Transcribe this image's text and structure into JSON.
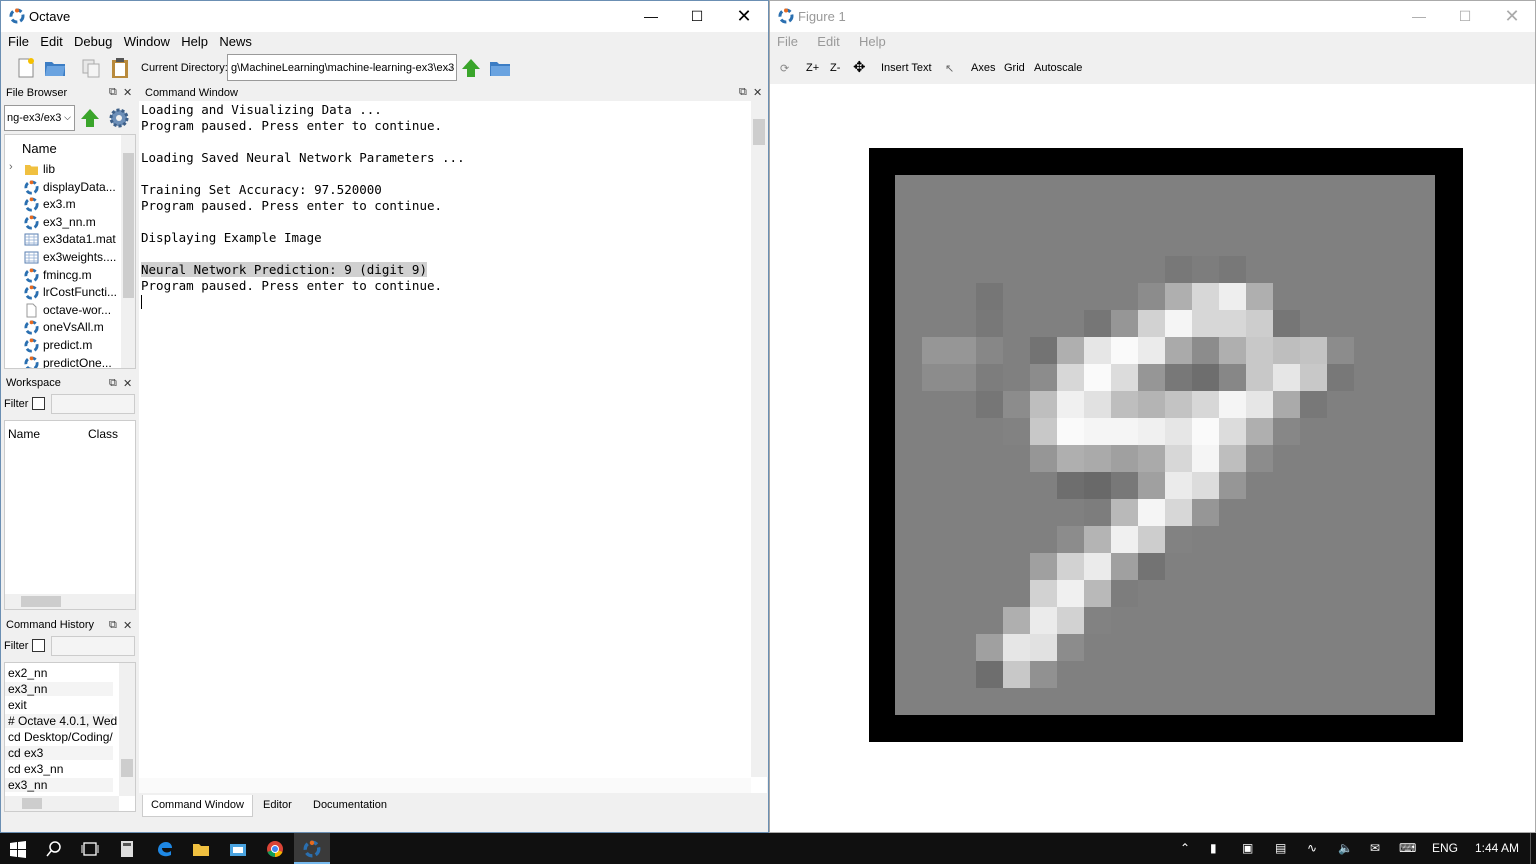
{
  "octave": {
    "title": "Octave",
    "menu": [
      "File",
      "Edit",
      "Debug",
      "Window",
      "Help",
      "News"
    ],
    "current_directory_label": "Current Directory:",
    "current_directory": "g\\MachineLearning\\machine-learning-ex3\\ex3",
    "file_browser": {
      "title": "File Browser",
      "path": "ng-ex3/ex3",
      "column_name": "Name",
      "items": [
        {
          "name": "lib",
          "type": "folder"
        },
        {
          "name": "displayData...",
          "type": "octave"
        },
        {
          "name": "ex3.m",
          "type": "octave"
        },
        {
          "name": "ex3_nn.m",
          "type": "octave"
        },
        {
          "name": "ex3data1.mat",
          "type": "mat"
        },
        {
          "name": "ex3weights....",
          "type": "mat"
        },
        {
          "name": "fmincg.m",
          "type": "octave"
        },
        {
          "name": "lrCostFuncti...",
          "type": "octave"
        },
        {
          "name": "octave-wor...",
          "type": "file"
        },
        {
          "name": "oneVsAll.m",
          "type": "octave"
        },
        {
          "name": "predict.m",
          "type": "octave"
        },
        {
          "name": "predictOne...",
          "type": "octave"
        }
      ]
    },
    "workspace": {
      "title": "Workspace",
      "filter_label": "Filter",
      "col_name": "Name",
      "col_class": "Class"
    },
    "history": {
      "title": "Command History",
      "filter_label": "Filter",
      "items": [
        "ex2_nn",
        "ex3_nn",
        "exit",
        "# Octave 4.0.1, Wed ...",
        "cd Desktop/Coding/",
        "cd ex3",
        "cd ex3_nn",
        "ex3_nn"
      ]
    },
    "command_window": {
      "title": "Command Window",
      "lines": [
        "Loading and Visualizing Data ...",
        "Program paused. Press enter to continue.",
        "",
        "Loading Saved Neural Network Parameters ...",
        "",
        "Training Set Accuracy: 97.520000",
        "Program paused. Press enter to continue.",
        "",
        "Displaying Example Image",
        "",
        "Neural Network Prediction: 9 (digit 9)",
        "Program paused. Press enter to continue."
      ]
    },
    "tabs": [
      "Command Window",
      "Editor",
      "Documentation"
    ]
  },
  "figure": {
    "title": "Figure 1",
    "menu": [
      "File",
      "Edit",
      "Help"
    ],
    "toolbar": [
      "Z+",
      "Z-",
      "Insert Text",
      "Axes",
      "Grid",
      "Autoscale"
    ],
    "image_description": "20x20 grayscale digit 9"
  },
  "taskbar": {
    "language": "ENG",
    "time": "1:44 AM"
  },
  "colors": {
    "accent": "#0078d7",
    "octave_orange": "#e66a1f",
    "octave_blue": "#2a6fb0"
  }
}
